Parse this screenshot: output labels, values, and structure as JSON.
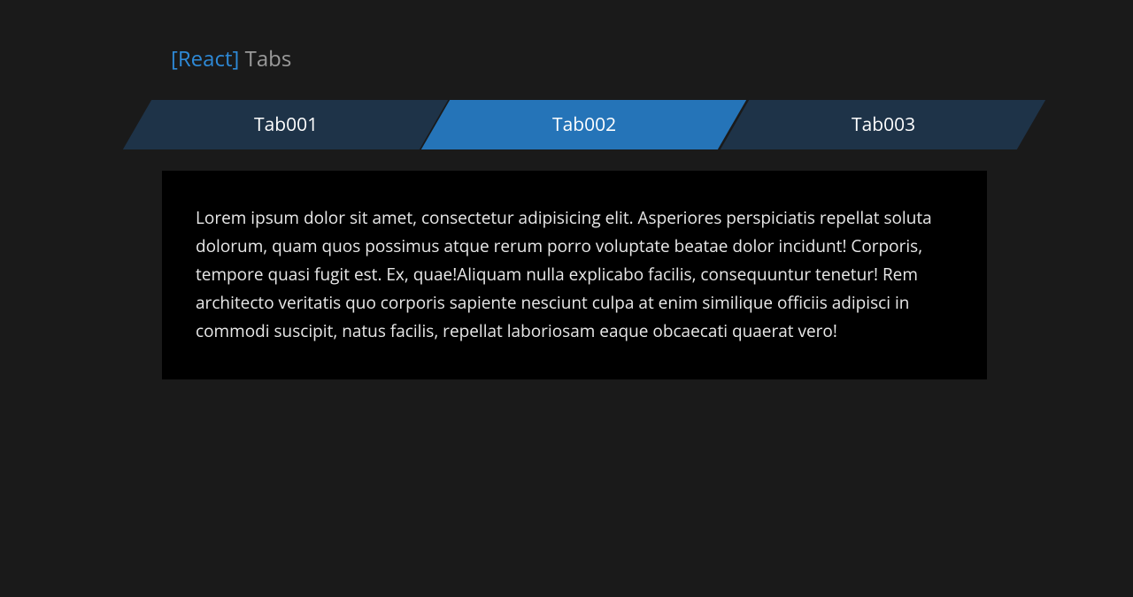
{
  "title": {
    "bracket": "[React]",
    "text": " Tabs"
  },
  "tabs": [
    {
      "label": "Tab001",
      "active": false
    },
    {
      "label": "Tab002",
      "active": true
    },
    {
      "label": "Tab003",
      "active": false
    }
  ],
  "content": "Lorem ipsum dolor sit amet, consectetur adipisicing elit. Asperiores perspiciatis repellat soluta dolorum, quam quos possimus atque rerum porro voluptate beatae dolor incidunt! Corporis, tempore quasi fugit est. Ex, quae!Aliquam nulla explicabo facilis, consequuntur tenetur! Rem architecto veritatis quo corporis sapiente nesciunt culpa at enim similique officiis adipisci in commodi suscipit, natus facilis, repellat laboriosam eaque obcaecati quaerat vero!"
}
